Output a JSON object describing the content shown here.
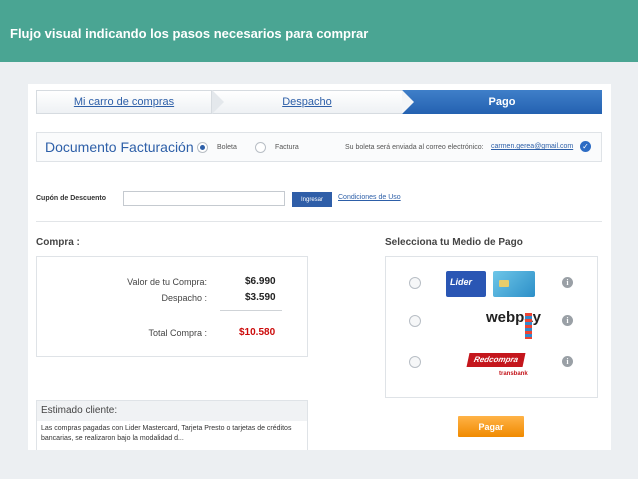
{
  "slide": {
    "title": "Flujo visual indicando los pasos necesarios para comprar"
  },
  "steps": [
    {
      "label": "Mi carro de compras"
    },
    {
      "label": "Despacho"
    },
    {
      "label": "Pago"
    }
  ],
  "billing": {
    "title": "Documento Facturación :",
    "option_boleta": "Boleta",
    "option_factura": "Factura",
    "selected": "Boleta",
    "notice": "Su boleta será enviada al correo electrónico:",
    "email": "carmen.gerea@gmail.com"
  },
  "coupon": {
    "label": "Cupón de Descuento",
    "value": "",
    "button": "Ingresar",
    "terms_link": "Condiciones de Uso"
  },
  "compra": {
    "title": "Compra :",
    "rows": [
      {
        "label": "Valor de tu Compra:",
        "value": "$6.990"
      },
      {
        "label": "Despacho :",
        "value": "$3.590"
      },
      {
        "label": "Total Compra :",
        "value": "$10.580"
      }
    ]
  },
  "estimado": {
    "title": "Estimado cliente:",
    "text": "Las compras pagadas con Lider Mastercard, Tarjeta Presto o tarjetas de créditos bancarias, se realizaron bajo la modalidad d..."
  },
  "payment": {
    "title": "Selecciona tu Medio de Pago",
    "options": [
      {
        "name": "Lider"
      },
      {
        "name": "webpay"
      },
      {
        "name": "Redcompra",
        "sub": "transbank"
      }
    ],
    "pay_button": "Pagar"
  },
  "colors": {
    "header": "#4aa593",
    "accent": "#2d5fa8",
    "total": "#cc0a0a",
    "pay": "#f08a00"
  }
}
